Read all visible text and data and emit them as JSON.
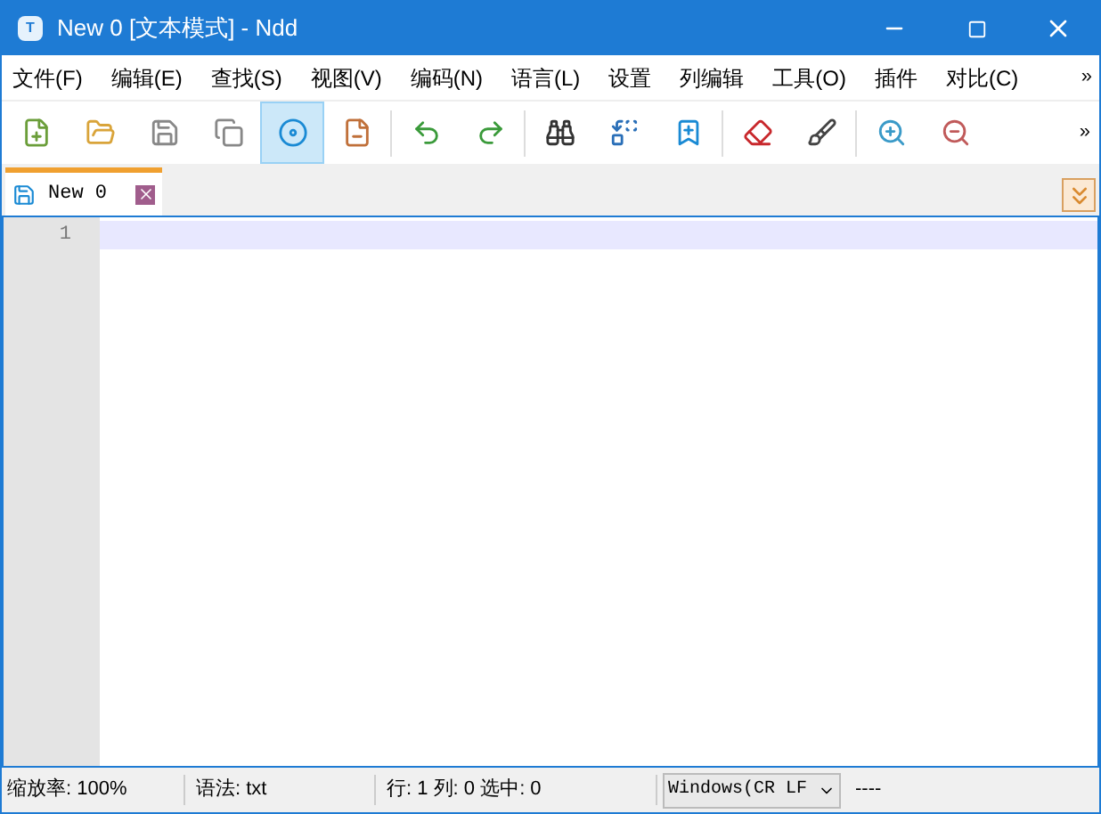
{
  "window": {
    "title": "New 0 [文本模式] - Ndd",
    "app_icon": "T"
  },
  "menu": [
    "文件(F)",
    "编辑(E)",
    "查找(S)",
    "视图(V)",
    "编码(N)",
    "语言(L)",
    "设置",
    "列编辑",
    "工具(O)",
    "插件",
    "对比(C)"
  ],
  "menu_overflow": "»",
  "toolbar": [
    {
      "selected": false
    },
    {
      "selected": false
    },
    {
      "selected": false
    },
    {
      "selected": false
    },
    {
      "selected": true
    },
    {
      "selected": false
    },
    {
      "selected": false
    },
    {
      "selected": false
    },
    {
      "selected": false
    },
    {
      "selected": false
    },
    {
      "selected": false
    },
    {
      "selected": false
    },
    {
      "selected": false
    },
    {
      "selected": false
    },
    {
      "selected": false
    }
  ],
  "toolbar_overflow": "»",
  "tabs": [
    {
      "label": "New 0",
      "selected": true
    }
  ],
  "editor": {
    "line_numbers": [
      "1"
    ]
  },
  "status_bar": {
    "zoom": "缩放率: 100%",
    "syntax": "语法: txt",
    "position": "行: 1 列: 0 选中: 0",
    "line_ending": "Windows(CR LF",
    "encoding": "----"
  }
}
